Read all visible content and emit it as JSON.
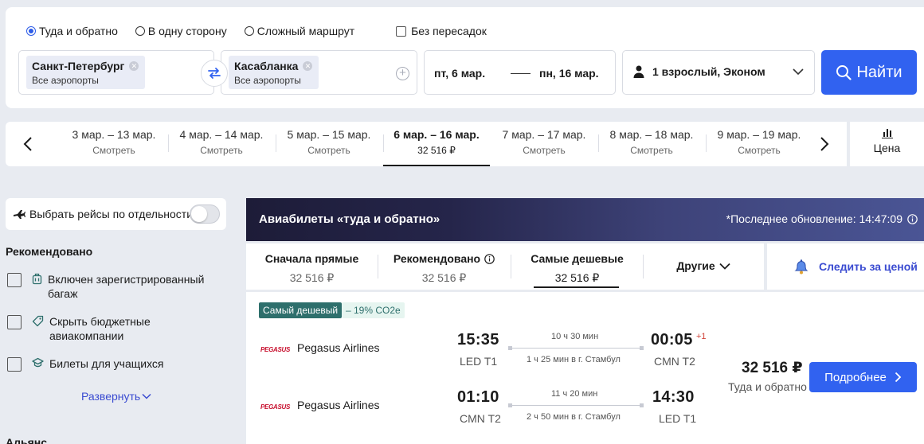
{
  "search": {
    "trip_types": [
      {
        "label": "Туда и обратно",
        "selected": true
      },
      {
        "label": "В одну сторону",
        "selected": false
      },
      {
        "label": "Сложный маршрут",
        "selected": false
      }
    ],
    "nonstop_label": "Без пересадок",
    "from": {
      "city": "Санкт-Петербург",
      "sub": "Все аэропорты"
    },
    "to": {
      "city": "Касабланка",
      "sub": "Все аэропорты"
    },
    "date_from": "пт, 6 мар.",
    "date_to": "пн, 16 мар.",
    "passengers": "1 взрослый, Эконом",
    "find_label": "Найти"
  },
  "date_strip": {
    "cells": [
      {
        "range": "3 мар. – 13 мар.",
        "sub": "Смотреть"
      },
      {
        "range": "4 мар. – 14 мар.",
        "sub": "Смотреть"
      },
      {
        "range": "5 мар. – 15 мар.",
        "sub": "Смотреть"
      },
      {
        "range": "6 мар. – 16 мар.",
        "sub": "32 516 ₽",
        "active": true
      },
      {
        "range": "7 мар. – 17 мар.",
        "sub": "Смотреть"
      },
      {
        "range": "8 мар. – 18 мар.",
        "sub": "Смотреть"
      },
      {
        "range": "9 мар. – 19 мар.",
        "sub": "Смотреть"
      }
    ],
    "price_sort_label": "Цена"
  },
  "filters": {
    "separate_label": "Выбрать рейсы по отдельности",
    "recommended_title": "Рекомендовано",
    "items": [
      {
        "label": "Включен зарегистрированный багаж",
        "icon": "baggage-icon"
      },
      {
        "label": "Скрыть бюджетные авиакомпании",
        "icon": "tag-icon"
      },
      {
        "label": "Билеты для учащихся",
        "icon": "student-cap-icon"
      }
    ],
    "expand_label": "Развернуть",
    "next_section_title": "Альянс"
  },
  "results": {
    "banner_title": "Авиабилеты «туда и обратно»",
    "last_update": "*Последнее обновление: 14:47:09",
    "sort_tabs": [
      {
        "label": "Сначала прямые",
        "price": "32 516 ₽"
      },
      {
        "label": "Рекомендовано",
        "price": "32 516 ₽",
        "info": true
      },
      {
        "label": "Самые дешевые",
        "price": "32 516 ₽",
        "active": true
      }
    ],
    "other_label": "Другие",
    "follow_price_label": "Следить за ценой",
    "offer": {
      "badge_cheapest": "Самый дешевый",
      "badge_co2": "– 19% CO2e",
      "legs": [
        {
          "airline": "Pegasus Airlines",
          "logo_text": "PEGASUS",
          "dep_time": "15:35",
          "dep_airport": "LED T1",
          "duration": "10 ч 30 мин",
          "stop": "1 ч 25 мин в г. Стамбул",
          "arr_time": "00:05",
          "arr_plus": "+1",
          "arr_airport": "CMN T2"
        },
        {
          "airline": "Pegasus Airlines",
          "logo_text": "PEGASUS",
          "dep_time": "01:10",
          "dep_airport": "CMN T2",
          "duration": "11 ч 20 мин",
          "stop": "2 ч 50 мин в г. Стамбул",
          "arr_time": "14:30",
          "arr_plus": "",
          "arr_airport": "LED T1"
        }
      ],
      "price": "32 516 ₽",
      "price_sub": "Туда и обратно",
      "details_label": "Подробнее"
    }
  }
}
